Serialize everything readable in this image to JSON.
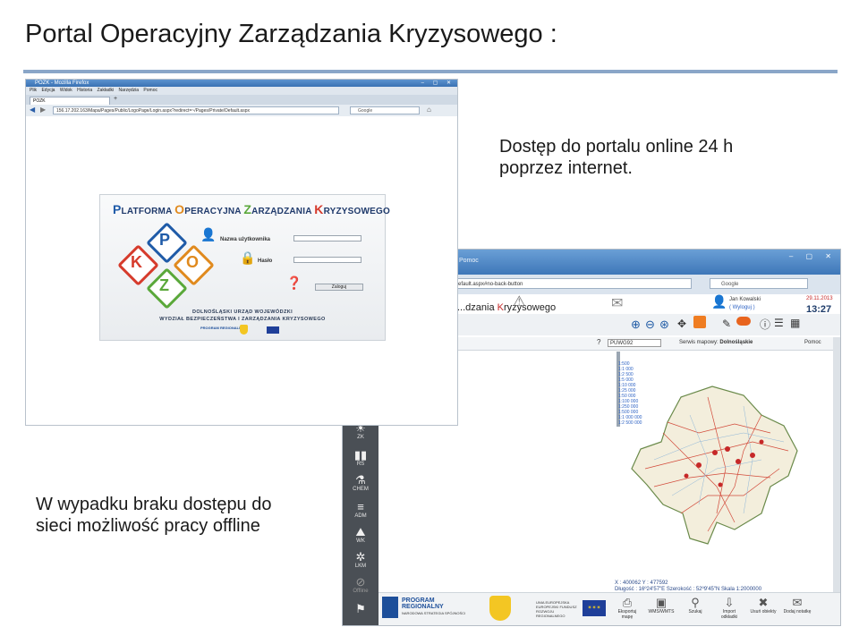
{
  "slide": {
    "title": "Portal Operacyjny Zarządzania Kryzysowego :",
    "caption_online_line1": "Dostęp do portalu online 24 h",
    "caption_online_line2": "poprzez internet.",
    "caption_offline_line1": "W wypadku braku dostępu do",
    "caption_offline_line2": "sieci możliwość pracy offline"
  },
  "login_screenshot": {
    "window_title": "POZK - Mozilla Firefox",
    "menu": [
      "Plik",
      "Edycja",
      "Widok",
      "Historia",
      "Zakładki",
      "Narzędzia",
      "Pomoc"
    ],
    "tab_label": "POZK",
    "url": "156.17.202.163/Mapa/Pages/Public/LogoPage/Login.aspx?redirect=~/Pages/Private/Default.aspx",
    "search_placeholder": "Google",
    "platform_title": {
      "w1_cap": "P",
      "w1_rest": "LATFORMA",
      "w2_cap": "O",
      "w2_rest": "PERACYJNA",
      "w3_cap": "Z",
      "w3_rest": "ARZĄDZANIA",
      "w4_cap": "K",
      "w4_rest": "RYZYSOWEGO"
    },
    "username_label": "Nazwa użytkownika",
    "password_label": "Hasło",
    "login_button": "Zaloguj",
    "institution_line1": "DOLNOŚLĄSKI URZĄD WOJEWÓDZKI",
    "institution_line2": "WYDZIAŁ BEZPIECZEŃSTWA I ZARZĄDZANIA KRYZYSOWEGO",
    "footer_logo_text": "PROGRAM REGIONALNY"
  },
  "map_screenshot": {
    "window_title": "Pomoc",
    "url": "...efault.aspx#no-back-button",
    "search_placeholder": "Google",
    "app_title_prefix": "...dzania ",
    "app_title_highlight": "K",
    "app_title_rest": "ryzysowego",
    "user_name": "Jan Kowalski",
    "logout_link": "( Wyloguj )",
    "date": "29.11.2013",
    "time": "13:27",
    "layer_select": "PUWG92",
    "map_service_label": "Serwis mapowy:",
    "map_service_value": "Dolnośląskie",
    "help_label": "Pomoc",
    "scales": [
      "1:500",
      "1:1 000",
      "1:2 500",
      "1:5 000",
      "1:10 000",
      "1:25 000",
      "1:50 000",
      "1:100 000",
      "1:250 000",
      "1:500 000",
      "1:1 000 000",
      "1:2 500 000"
    ],
    "sidebar": [
      "ZK",
      "RS",
      "CHEM",
      "ADM",
      "WK",
      "LKM",
      "Offline"
    ],
    "coords_line1": "X : 400062  Y : 477592",
    "coords_line2": "Długość : 16º24'57\"E  Szerokość : 52º9'45\"N  Skala 1:2000000",
    "footer_program_line1": "PROGRAM",
    "footer_program_line2": "REGIONALNY",
    "footer_program_line3": "NARODOWA STRATEGIA SPÓJNOŚCI",
    "footer_eu_text": "UNIA EUROPEJSKA EUROPEJSKI FUNDUSZ ROZWOJU REGIONALNEGO",
    "footer_tools": [
      "Eksportuj mapę",
      "WMS/WMTS",
      "Szukaj",
      "Import odkładki",
      "Usuń obiekty",
      "Dodaj notatkę"
    ],
    "colors": {
      "title_red": "#c62828",
      "time_blue": "#1f3d6b",
      "sidebar_bg": "#4a4f55"
    }
  },
  "colors": {
    "title_rule": "#8aa6c8",
    "text": "#1a1a1a"
  }
}
